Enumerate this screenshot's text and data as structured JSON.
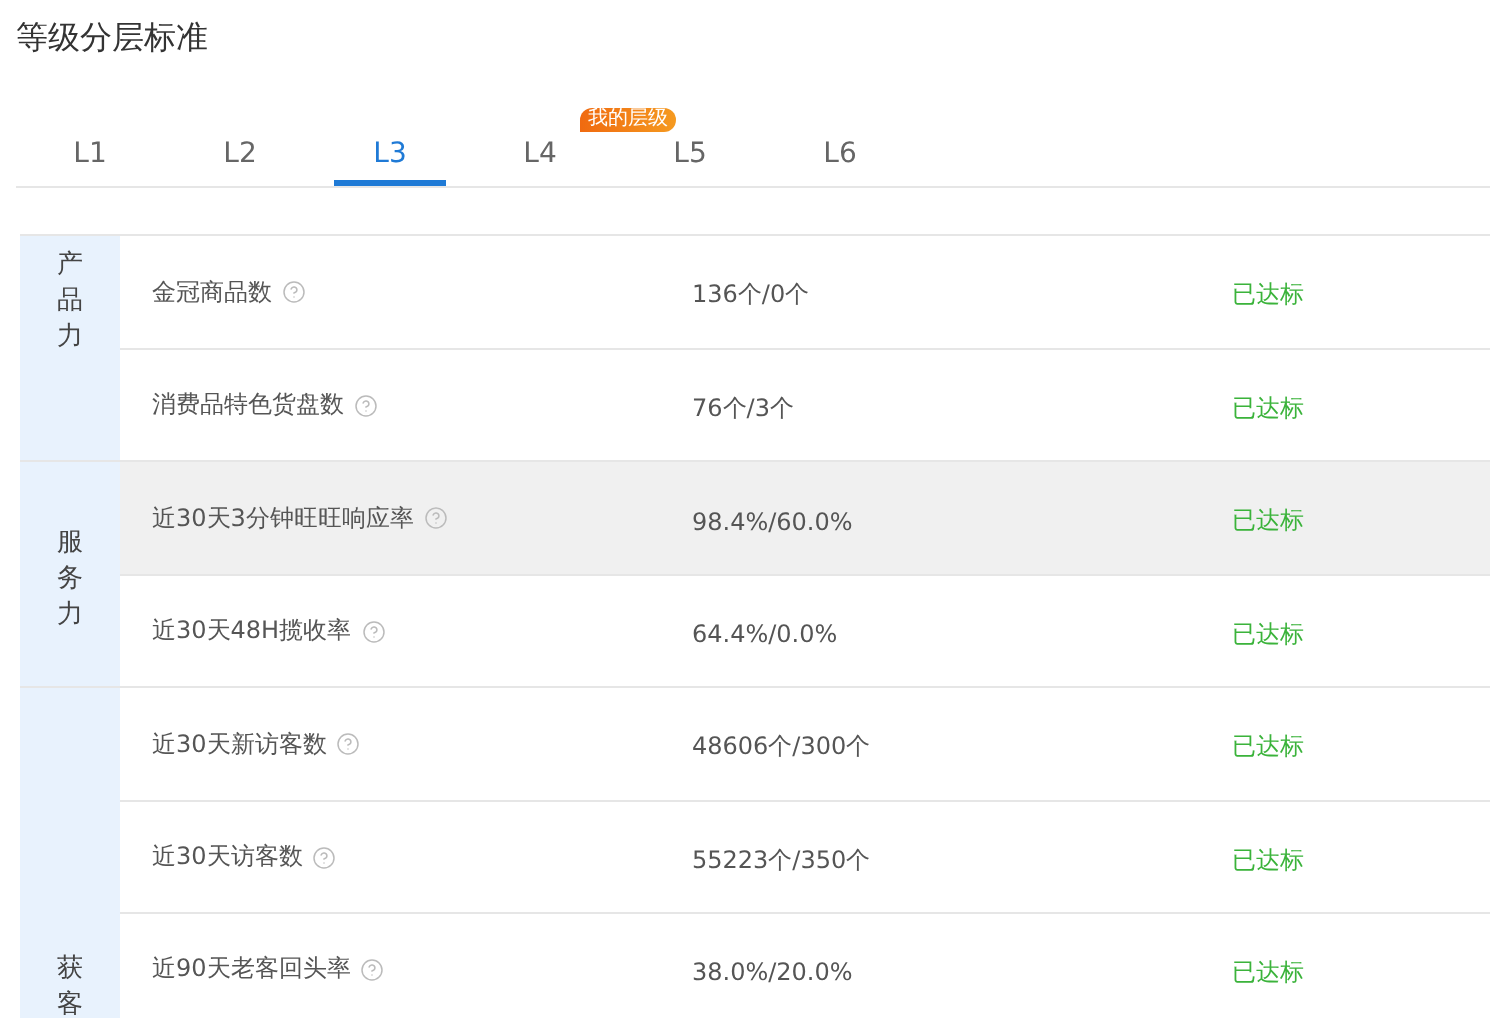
{
  "title": "等级分层标准",
  "tabs": [
    {
      "label": "L1",
      "selected": false
    },
    {
      "label": "L2",
      "selected": false
    },
    {
      "label": "L3",
      "selected": true
    },
    {
      "label": "L4",
      "selected": false,
      "badge": "我的层级"
    },
    {
      "label": "L5",
      "selected": false
    },
    {
      "label": "L6",
      "selected": false
    }
  ],
  "groups": [
    {
      "category": "产品力",
      "rows": [
        {
          "metric": "金冠商品数",
          "value": "136个/0个",
          "status": "已达标",
          "highlighted": false
        },
        {
          "metric": "消费品特色货盘数",
          "value": "76个/3个",
          "status": "已达标",
          "highlighted": false
        }
      ]
    },
    {
      "category": "服务力",
      "rows": [
        {
          "metric": "近30天3分钟旺旺响应率",
          "value": "98.4%/60.0%",
          "status": "已达标",
          "highlighted": true
        },
        {
          "metric": "近30天48H揽收率",
          "value": "64.4%/0.0%",
          "status": "已达标",
          "highlighted": false
        }
      ]
    },
    {
      "category": "获客",
      "rows": [
        {
          "metric": "近30天新访客数",
          "value": "48606个/300个",
          "status": "已达标",
          "highlighted": false
        },
        {
          "metric": "近30天访客数",
          "value": "55223个/350个",
          "status": "已达标",
          "highlighted": false
        },
        {
          "metric": "近90天老客回头率",
          "value": "38.0%/20.0%",
          "status": "已达标",
          "highlighted": false
        }
      ]
    }
  ]
}
